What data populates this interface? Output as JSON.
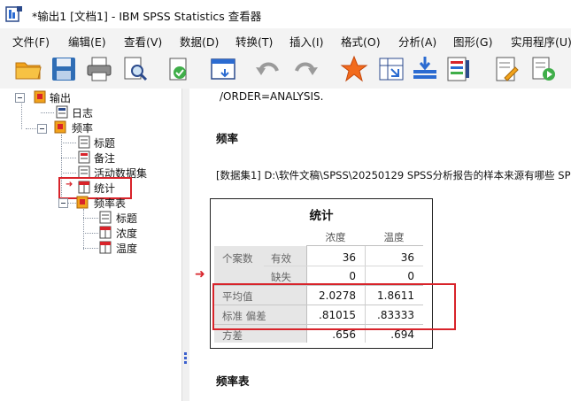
{
  "window": {
    "title": "*输出1 [文档1] - IBM SPSS Statistics 查看器",
    "app_icon": "spss-viewer-icon"
  },
  "menu": [
    "文件(F)",
    "编辑(E)",
    "查看(V)",
    "数据(D)",
    "转换(T)",
    "插入(I)",
    "格式(O)",
    "分析(A)",
    "图形(G)",
    "实用程序(U)"
  ],
  "toolbar": [
    "open-folder-icon",
    "save-icon",
    "print-icon",
    "print-preview-icon",
    "export-icon",
    "recall-dialog-icon",
    "undo-icon",
    "redo-icon",
    "goto-case-icon",
    "goto-variable-icon",
    "insert-cases-icon",
    "variables-icon",
    "designate-window-icon",
    "run-script-icon"
  ],
  "outline": {
    "root": "输出",
    "log": "日志",
    "frequencies": "频率",
    "freq_children": [
      "标题",
      "备注",
      "活动数据集",
      "统计"
    ],
    "freq_tables": "频率表",
    "freq_table_children": [
      "标题",
      "浓度",
      "温度"
    ],
    "selected": "统计"
  },
  "contents": {
    "syntax_line": "/ORDER=ANALYSIS.",
    "heading_freq": "频率",
    "dataset_line": "[数据集1] D:\\软件文稿\\SPSS\\20250129 SPSS分析报告的样本来源有哪些 SPSS",
    "heading_freq_table": "频率表"
  },
  "stats_table": {
    "title": "统计",
    "columns": [
      "浓度",
      "温度"
    ],
    "rows": [
      {
        "label": "个案数",
        "sub": "有效",
        "values": [
          "36",
          "36"
        ]
      },
      {
        "label": "",
        "sub": "缺失",
        "values": [
          "0",
          "0"
        ]
      },
      {
        "label": "平均值",
        "sub": "",
        "values": [
          "2.0278",
          "1.8611"
        ]
      },
      {
        "label": "标准 偏差",
        "sub": "",
        "values": [
          ".81015",
          ".83333"
        ]
      },
      {
        "label": "方差",
        "sub": "",
        "values": [
          ".656",
          ".694"
        ]
      }
    ]
  },
  "colors": {
    "highlight_red": "#d8232a",
    "table_band": "#e6e6e6"
  }
}
